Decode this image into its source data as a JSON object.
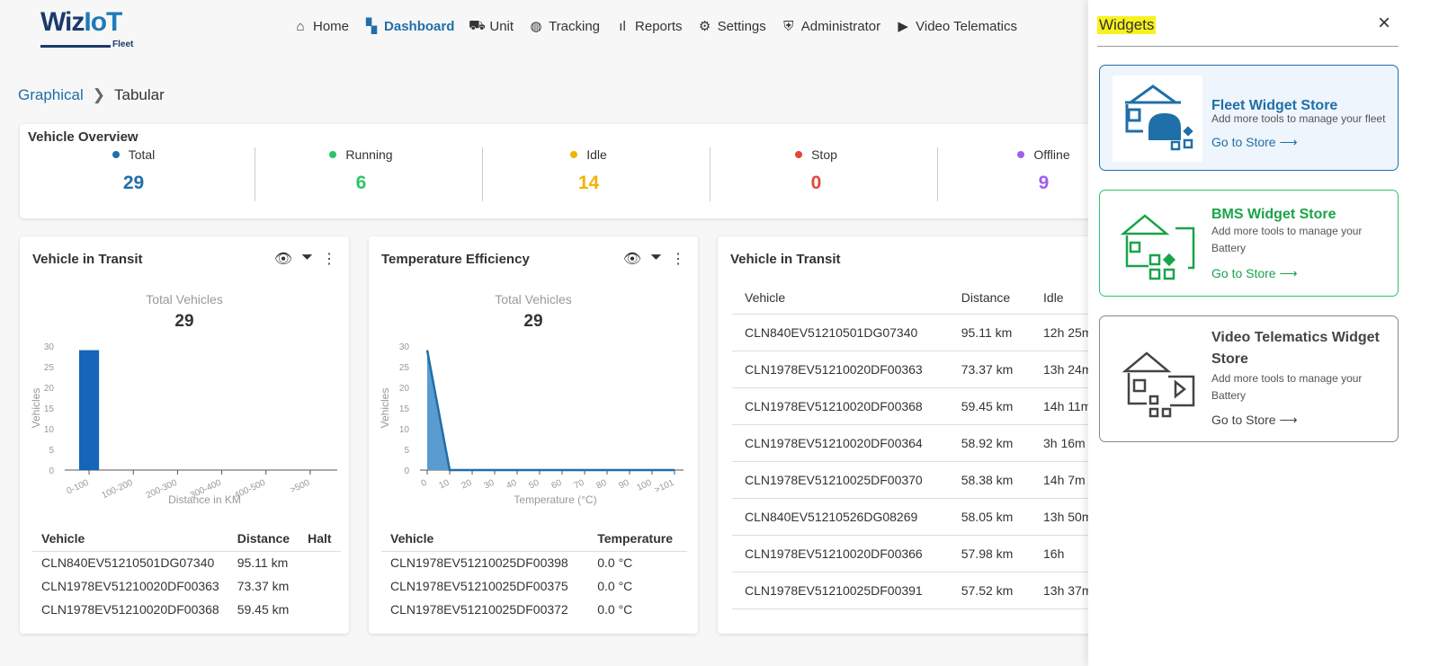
{
  "logo": {
    "brand": "WizIoT",
    "sub": "Fleet"
  },
  "nav": [
    {
      "label": "Home",
      "icon": "home-icon"
    },
    {
      "label": "Dashboard",
      "icon": "dashboard-icon",
      "active": true
    },
    {
      "label": "Unit",
      "icon": "unit-icon"
    },
    {
      "label": "Tracking",
      "icon": "globe-icon"
    },
    {
      "label": "Reports",
      "icon": "bar-chart-icon"
    },
    {
      "label": "Settings",
      "icon": "gear-icon"
    },
    {
      "label": "Administrator",
      "icon": "shield-icon"
    },
    {
      "label": "Video Telematics",
      "icon": "video-icon"
    }
  ],
  "breadcrumb": {
    "graphical": "Graphical",
    "tabular": "Tabular"
  },
  "overview": {
    "title": "Vehicle Overview",
    "stats": [
      {
        "label": "Total",
        "value": "29",
        "color": "#1f6fa8"
      },
      {
        "label": "Running",
        "value": "6",
        "color": "#2ec36b"
      },
      {
        "label": "Idle",
        "value": "14",
        "color": "#f0b400"
      },
      {
        "label": "Stop",
        "value": "0",
        "color": "#e8443a"
      },
      {
        "label": "Offline",
        "value": "9",
        "color": "#a45cf0"
      }
    ]
  },
  "transit": {
    "title": "Vehicle in Transit",
    "total_label": "Total Vehicles",
    "total": "29",
    "headers": [
      "Vehicle",
      "Distance",
      "Halt"
    ],
    "rows": [
      [
        "CLN840EV51210501DG07340",
        "95.11 km",
        ""
      ],
      [
        "CLN1978EV51210020DF00363",
        "73.37 km",
        ""
      ],
      [
        "CLN1978EV51210020DF00368",
        "59.45 km",
        ""
      ]
    ]
  },
  "temp": {
    "title": "Temperature Efficiency",
    "total_label": "Total Vehicles",
    "total": "29",
    "headers": [
      "Vehicle",
      "Temperature"
    ],
    "rows": [
      [
        "CLN1978EV51210025DF00398",
        "0.0 °C"
      ],
      [
        "CLN1978EV51210025DF00375",
        "0.0 °C"
      ],
      [
        "CLN1978EV51210025DF00372",
        "0.0 °C"
      ]
    ]
  },
  "transit2": {
    "title": "Vehicle in Transit",
    "headers": [
      "Vehicle",
      "Distance",
      "Idle"
    ],
    "rows": [
      [
        "CLN840EV51210501DG07340",
        "95.11 km",
        "12h 25m"
      ],
      [
        "CLN1978EV51210020DF00363",
        "73.37 km",
        "13h 24m"
      ],
      [
        "CLN1978EV51210020DF00368",
        "59.45 km",
        "14h 11m"
      ],
      [
        "CLN1978EV51210020DF00364",
        "58.92 km",
        "3h 16m"
      ],
      [
        "CLN1978EV51210025DF00370",
        "58.38 km",
        "14h 7m"
      ],
      [
        "CLN840EV51210526DG08269",
        "58.05 km",
        "13h 50m"
      ],
      [
        "CLN1978EV51210020DF00366",
        "57.98 km",
        "16h"
      ],
      [
        "CLN1978EV51210025DF00391",
        "57.52 km",
        "13h 37m"
      ]
    ]
  },
  "chart_data": [
    {
      "type": "bar",
      "categories": [
        "0-100",
        "100-200",
        "200-300",
        "300-400",
        "400-500",
        ">500"
      ],
      "values": [
        29,
        0,
        0,
        0,
        0,
        0
      ],
      "xlabel": "Distance in KM",
      "ylabel": "Vehicles",
      "ylim": [
        0,
        30
      ],
      "yticks": [
        0,
        5,
        10,
        15,
        20,
        25,
        30
      ],
      "color": "#1565b8"
    },
    {
      "type": "area",
      "categories": [
        "0",
        "10",
        "20",
        "30",
        "40",
        "50",
        "60",
        "70",
        "80",
        "90",
        "100",
        ">101"
      ],
      "values": [
        29,
        0,
        0,
        0,
        0,
        0,
        0,
        0,
        0,
        0,
        0,
        0
      ],
      "xlabel": "Temperature (°C)",
      "ylabel": "Vehicles",
      "ylim": [
        0,
        30
      ],
      "yticks": [
        0,
        5,
        10,
        15,
        20,
        25,
        30
      ],
      "color": "#1f6fa8"
    }
  ],
  "panel": {
    "title": "Widgets",
    "close": "×",
    "stores": [
      {
        "title": "Fleet Widget Store",
        "desc": "Add more tools to manage your fleet",
        "link": "Go to Store ⟶",
        "color": "#1f6fa8"
      },
      {
        "title": "BMS Widget Store",
        "desc": "Add more tools to manage your Battery",
        "link": "Go to Store ⟶",
        "color": "#1aa34a"
      },
      {
        "title": "Video Telematics Widget Store",
        "desc": "Add more tools to manage your Battery",
        "link": "Go to Store ⟶",
        "color": "#444"
      }
    ]
  }
}
